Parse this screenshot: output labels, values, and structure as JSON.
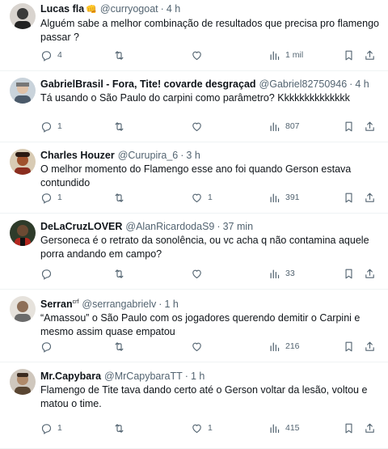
{
  "tweets": [
    {
      "name": "Lucas fla",
      "emoji": "👊",
      "handle": "@curryogoat",
      "time": "4 h",
      "text": "Alguém sabe a melhor combinação de resultados que precisa pro flamengo\npassar ?",
      "replies": "4",
      "retweets": "",
      "likes": "",
      "views": "1 mil",
      "avatar_color": "#3a3a3a"
    },
    {
      "name": "GabrielBrasil - Fora, Tite! covarde desgraçad",
      "handle": "@Gabriel82750946",
      "time": "4 h",
      "text": "Tá usando o São Paulo do carpini como parâmetro? Kkkkkkkkkkkkkk",
      "replies": "1",
      "retweets": "",
      "likes": "",
      "views": "807",
      "avatar_color": "#7a8a99"
    },
    {
      "name": "Charles Houzer",
      "handle": "@Curupira_6",
      "time": "3 h",
      "text": "O melhor momento do Flamengo esse ano foi quando Gerson estava\ncontundido",
      "replies": "1",
      "retweets": "",
      "likes": "1",
      "views": "391",
      "avatar_color": "#8b2d1f"
    },
    {
      "name": "DeLaCruzLOVER",
      "handle": "@AlanRicardodaS9",
      "time": "37 min",
      "text": "Gersoneca é o retrato da sonolência, ou vc acha q não contamina aquele\nporra andando em campo?",
      "replies": "",
      "retweets": "",
      "likes": "",
      "views": "33",
      "avatar_color": "#4a3b2a"
    },
    {
      "name": "Serran",
      "name_sup": "crf",
      "handle": "@serrangabrielv",
      "time": "1 h",
      "text": "“Amassou” o São Paulo com os jogadores querendo demitir o Carpini e\nmesmo assim quase empatou",
      "replies": "",
      "retweets": "",
      "likes": "",
      "views": "216",
      "avatar_color": "#6b6b6b"
    },
    {
      "name": "Mr.Capybara",
      "handle": "@MrCapybaraTT",
      "time": "1 h",
      "text": "Flamengo de Tite tava dando certo até o Gerson voltar da lesão, voltou e\nmatou o time.",
      "replies": "1",
      "retweets": "",
      "likes": "1",
      "views": "415",
      "avatar_color": "#5a4632"
    }
  ],
  "dot": "·",
  "icons": {
    "reply": "reply-icon",
    "retweet": "retweet-icon",
    "like": "heart-icon",
    "views": "views-icon",
    "bookmark": "bookmark-icon",
    "share": "share-icon"
  },
  "colors": {
    "text": "#0f1419",
    "secondary": "#536471",
    "divider": "#eff3f4"
  }
}
